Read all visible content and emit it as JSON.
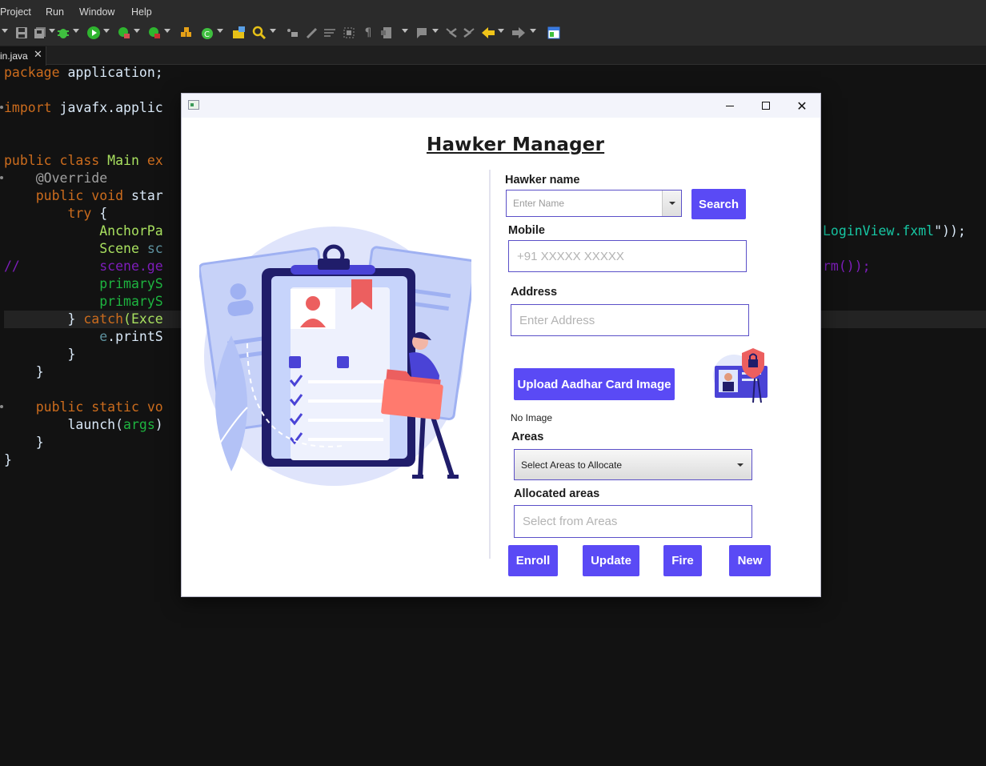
{
  "ide": {
    "menu": [
      "Project",
      "Run",
      "Window",
      "Help"
    ],
    "tab": {
      "label": "in.java",
      "close": "✕"
    },
    "toolbar_icons": [
      "collapse-icon",
      "save-icon",
      "save-all-icon",
      "debug-icon",
      "run-icon",
      "run-coverage-icon",
      "external-tools-icon",
      "new-package-icon",
      "new-class-icon",
      "open-type-icon",
      "search-icon",
      "toggle-mark-icon",
      "edit-icon",
      "word-wrap-icon",
      "block-select-icon",
      "show-whitespace-icon",
      "annotation-icon",
      "previous-annotation-icon",
      "last-edit-icon",
      "next-edit-icon",
      "back-icon",
      "forward-icon",
      "perspective-icon"
    ],
    "code": {
      "line1": {
        "kw": "package",
        "rest": " application;"
      },
      "line2": {
        "kw": "import",
        "rest": " javafx.applic"
      },
      "line3": {
        "kw1": "public",
        "kw2": " class",
        "type": " Main",
        "kw3": " ex"
      },
      "line4": {
        "ann": "    @Override"
      },
      "line5": {
        "kw1": "    public",
        "kw2": " void",
        "rest": " star"
      },
      "line6": {
        "kw": "        try",
        "rest": " {"
      },
      "line7": {
        "type": "            AnchorPa",
        "right": "LoginView.fxml",
        "right_tail": "\"));"
      },
      "line8": {
        "type": "            Scene",
        "var": " sc"
      },
      "line9": {
        "comment": "//          scene.ge",
        "right": "rm());"
      },
      "line10": {
        "var": "            primaryS"
      },
      "line11": {
        "var": "            primaryS"
      },
      "line12": {
        "pre": "        } ",
        "kw": "catch",
        "rest": "(Exce"
      },
      "line13": {
        "pre": "            ",
        "var": "e",
        "rest": ".printS"
      },
      "line14": {
        "rest": "        }"
      },
      "line15": {
        "rest": "    }"
      },
      "line16": {
        "kw1": "    public",
        "kw2": " static",
        "kw3": " vo"
      },
      "line17": {
        "pre": "        launch(",
        "var": "args",
        "rest": ")"
      },
      "line18": {
        "rest": "    }"
      },
      "line19": {
        "rest": "}"
      }
    }
  },
  "window": {
    "title": "Hawker Manager",
    "controls": {
      "minimize": "minimize",
      "maximize": "maximize",
      "close": "✕"
    },
    "form": {
      "hawker_name_label": "Hawker name",
      "hawker_name_placeholder": "Enter Name",
      "search_label": "Search",
      "mobile_label": "Mobile",
      "mobile_placeholder": "+91 XXXXX XXXXX",
      "address_label": "Address",
      "address_placeholder": "Enter Address",
      "upload_label": "Upload Aadhar Card Image",
      "no_image": "No Image",
      "areas_label": "Areas",
      "areas_select": "Select Areas to Allocate",
      "allocated_label": "Allocated areas",
      "allocated_placeholder": "Select from Areas"
    },
    "actions": {
      "enroll": "Enroll",
      "update": "Update",
      "fire": "Fire",
      "new": "New"
    }
  },
  "colors": {
    "accent": "#5a4af5",
    "input_border": "#5b50c8",
    "ide_bg": "#121212"
  }
}
